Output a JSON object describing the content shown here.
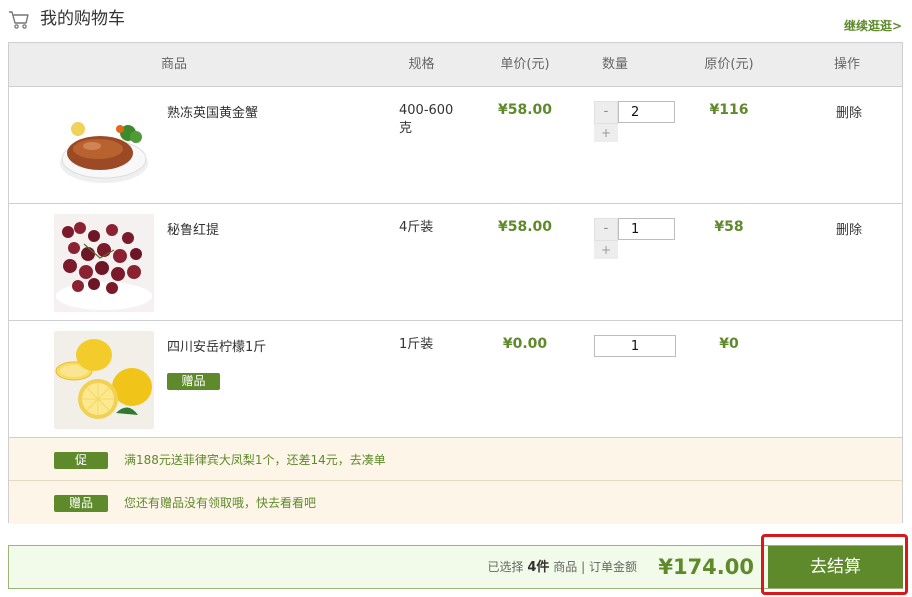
{
  "header": {
    "title": "我的购物车",
    "continue_link": "继续逛逛>"
  },
  "table": {
    "headers": {
      "product": "商品",
      "spec": "规格",
      "unit_price": "单价(元)",
      "quantity": "数量",
      "original_price": "原价(元)",
      "action": "操作"
    },
    "rows": [
      {
        "name": "熟冻英国黄金蟹",
        "spec": "400-600克",
        "price": "¥58.00",
        "qty": "2",
        "minus": "-",
        "plus": "+",
        "orig": "¥116",
        "action": "删除"
      },
      {
        "name": "秘鲁红提",
        "spec": "4斤装",
        "price": "¥58.00",
        "qty": "1",
        "minus": "-",
        "plus": "+",
        "orig": "¥58",
        "action": "删除"
      },
      {
        "name": "四川安岳柠檬1斤",
        "spec": "1斤装",
        "price": "¥0.00",
        "qty": "1",
        "orig": "¥0",
        "badge": "赠品"
      }
    ]
  },
  "promos": [
    {
      "tag": "促",
      "text": "满188元送菲律宾大凤梨1个，还差14元，去凑单"
    },
    {
      "tag": "赠品",
      "text": "您还有赠品没有领取哦，快去看看吧"
    }
  ],
  "summary": {
    "selected_prefix": "已选择",
    "selected_count": "4件",
    "selected_suffix": "商品",
    "separator": "|",
    "order_label": "订单金额",
    "total": "¥174.00",
    "checkout_label": "去结算"
  },
  "colors": {
    "accent": "#5e8a2c",
    "promo_bg": "#fdf5e7",
    "highlight": "#d7191c"
  }
}
